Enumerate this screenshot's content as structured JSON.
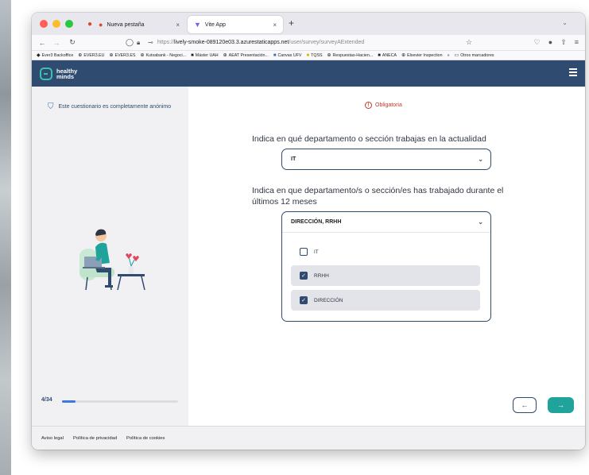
{
  "browser": {
    "tabs": [
      {
        "label": "Nueva pestaña",
        "active": false
      },
      {
        "label": "Vite App",
        "active": true
      }
    ],
    "new_tab_symbol": "+",
    "close_symbol": "×",
    "url_prefix": "https://",
    "url_host": "lively-smoke-089120e03.3.azurestaticapps.net",
    "url_path": "/user/survey/surveyAExtended",
    "bookmarks": [
      "Ever3 Backoffice",
      "EVER3.EU",
      "EVER3.ES",
      "Kutxabank - Negoci...",
      "Máster UAH",
      "AEAT Presentación...",
      "Canvas UFV",
      "TQSS",
      "Respuestas-Hacien...",
      "ANECA",
      "Elsevier Inspection"
    ],
    "bookmarks_overflow": "»",
    "other_bookmarks": "Otros marcadores"
  },
  "app": {
    "logo_line1": "healthy",
    "logo_line2": "minds",
    "brand_color": "#2f4b70",
    "accent_color": "#1fa39a"
  },
  "sidebar": {
    "anonymous_notice": "Este cuestionario es completamente anónimo",
    "progress_label": "4/34",
    "progress_fraction": 0.118
  },
  "survey": {
    "required_label": "Obligatoria",
    "question1": "Indica en qué departamento o sección trabajas en la actualidad",
    "answer1": "IT",
    "question2": "Indica en que departamento/s o sección/es has trabajado durante el últimos 12 meses",
    "answer2": "DIRECCIÓN, RRHH",
    "options": [
      {
        "label": "IT",
        "checked": false
      },
      {
        "label": "RRHH",
        "checked": true
      },
      {
        "label": "DIRECCIÓN",
        "checked": true
      }
    ],
    "back_symbol": "←",
    "next_symbol": "→"
  },
  "footer": {
    "links": [
      "Aviso legal",
      "Política de privacidad",
      "Política de cookies"
    ]
  }
}
